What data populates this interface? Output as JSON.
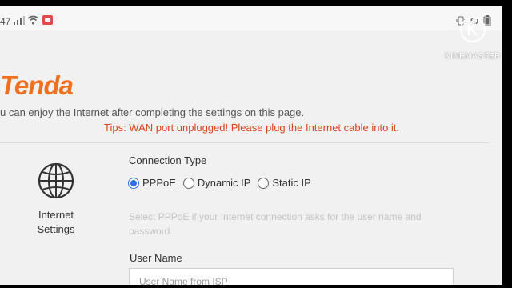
{
  "status_bar": {
    "time": "47",
    "icons": [
      "signal-icon",
      "wifi-icon",
      "notification-icon",
      "vibrate-icon",
      "rotate-icon",
      "battery-icon"
    ]
  },
  "watermark": {
    "text": "KINEMASTER"
  },
  "brand": {
    "logo_text": "Tenda",
    "color": "#f07020"
  },
  "intro_text": "u can enjoy the Internet after completing the settings on this page.",
  "tips_text": "Tips: WAN port unplugged! Please plug the Internet cable into it.",
  "section": {
    "icon": "globe-icon",
    "label": "Internet Settings"
  },
  "connection": {
    "label": "Connection Type",
    "options": [
      "PPPoE",
      "Dynamic IP",
      "Static IP"
    ],
    "selected": "PPPoE",
    "hint": "Select PPPoE if your Internet connection asks for the user name and password."
  },
  "user_name": {
    "label": "User Name",
    "placeholder": "User Name from ISP",
    "value": ""
  },
  "colors": {
    "accent": "#2f6fe0",
    "tips": "#e0401a",
    "background": "#f1f1f1"
  }
}
